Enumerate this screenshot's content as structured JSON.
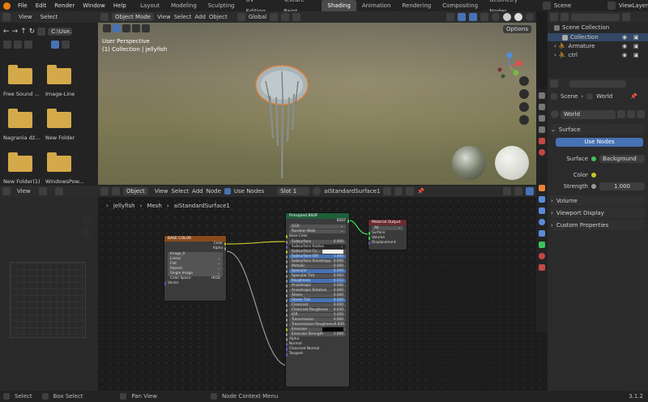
{
  "topbar": {
    "menus": [
      "File",
      "Edit",
      "Render",
      "Window",
      "Help"
    ],
    "workspace_tabs": [
      "Layout",
      "Modeling",
      "Sculpting",
      "UV Editing",
      "Texture Paint",
      "Shading",
      "Animation",
      "Rendering",
      "Compositing",
      "Geometry Nodes"
    ],
    "active_tab": "Shading",
    "scene": "Scene",
    "view_layer": "ViewLayer"
  },
  "file_browser": {
    "header_menus": [
      "View",
      "Select"
    ],
    "path": "C:\\Use...",
    "folders": [
      "Free Sound ...",
      "Image-Line",
      "Nagrania dź...",
      "New Folder",
      "New Folder(1)",
      "WindowsPow..."
    ]
  },
  "viewport": {
    "mode": "Object Mode",
    "menus": [
      "View",
      "Select",
      "Add",
      "Object"
    ],
    "transform": "Global",
    "options": "Options",
    "overlay_title": "User Perspective",
    "overlay_sub": "(1) Collection | jellyfish",
    "gizmo": {
      "x": "X",
      "y": "Y",
      "z": "Z"
    }
  },
  "image_editor": {
    "menus": [
      "View"
    ]
  },
  "node_editor": {
    "object": "Object",
    "menus": [
      "View",
      "Select",
      "Add",
      "Node"
    ],
    "use_nodes": "Use Nodes",
    "slot": "Slot 1",
    "material": "aiStandardSurface1",
    "breadcrumb": [
      "jellyfish",
      "Mesh",
      "aiStandardSurface1"
    ],
    "base_color_node": {
      "title": "BASE COLOR",
      "outputs": [
        "Color",
        "Alpha"
      ],
      "image": "Image_0",
      "options": [
        "Linear",
        "Flat",
        "Repeat",
        "Single Image"
      ],
      "color_space_label": "Color Space",
      "color_space": "sRGB",
      "vector": "Vector"
    },
    "bsdf_node": {
      "title": "Principled BSDF",
      "output": "BSDF",
      "distribution": "GGX",
      "subsurface_method": "Random Walk",
      "inputs": [
        {
          "label": "Base Color",
          "value": "",
          "kind": "plain"
        },
        {
          "label": "Subsurface",
          "value": "0.000",
          "kind": "field"
        },
        {
          "label": "Subsurface Radius",
          "value": "",
          "kind": "drop"
        },
        {
          "label": "Subsurface Co...",
          "value": "",
          "kind": "white"
        },
        {
          "label": "Subsurface IOR",
          "value": "1.400",
          "kind": "fill"
        },
        {
          "label": "Subsurface Anisotropy",
          "value": "0.000",
          "kind": "field"
        },
        {
          "label": "Metallic",
          "value": "0.000",
          "kind": "field"
        },
        {
          "label": "Specular",
          "value": "0.500",
          "kind": "fill"
        },
        {
          "label": "Specular Tint",
          "value": "0.000",
          "kind": "field"
        },
        {
          "label": "Roughness",
          "value": "0.553",
          "kind": "fill"
        },
        {
          "label": "Anisotropic",
          "value": "0.000",
          "kind": "field"
        },
        {
          "label": "Anisotropic Rotation",
          "value": "0.000",
          "kind": "field"
        },
        {
          "label": "Sheen",
          "value": "0.000",
          "kind": "field"
        },
        {
          "label": "Sheen Tint",
          "value": "0.500",
          "kind": "fill"
        },
        {
          "label": "Clearcoat",
          "value": "0.000",
          "kind": "field"
        },
        {
          "label": "Clearcoat Roughness",
          "value": "0.030",
          "kind": "field"
        },
        {
          "label": "IOR",
          "value": "1.450",
          "kind": "field"
        },
        {
          "label": "Transmission",
          "value": "0.000",
          "kind": "field"
        },
        {
          "label": "Transmission Roughness",
          "value": "0.000",
          "kind": "field"
        },
        {
          "label": "Emission",
          "value": "",
          "kind": "black"
        },
        {
          "label": "Emission Strength",
          "value": "1.000",
          "kind": "field"
        },
        {
          "label": "Alpha",
          "value": "",
          "kind": "plain"
        },
        {
          "label": "Normal",
          "value": "",
          "kind": "plain"
        },
        {
          "label": "Clearcoat Normal",
          "value": "",
          "kind": "plain"
        },
        {
          "label": "Tangent",
          "value": "",
          "kind": "plain"
        }
      ]
    },
    "output_node": {
      "title": "Material Output",
      "target": "All",
      "inputs": [
        "Surface",
        "Volume",
        "Displacement"
      ]
    }
  },
  "outliner": {
    "items": [
      "Scene Collection",
      "Collection",
      "Armature",
      "ctrl"
    ]
  },
  "properties": {
    "breadcrumb": [
      "Scene",
      "World"
    ],
    "world_name": "World",
    "surface_panel": "Surface",
    "use_nodes_btn": "Use Nodes",
    "surface_label": "Surface",
    "surface_value": "Background",
    "color_label": "Color",
    "strength_label": "Strength",
    "strength_value": "1.000",
    "panels": [
      "Volume",
      "Viewport Display",
      "Custom Properties"
    ]
  },
  "statusbar": {
    "items": [
      "Select",
      "Box Select",
      "Pan View",
      "Node Context Menu"
    ],
    "version": "3.1.2"
  },
  "colors": {
    "accent": "#4772b3",
    "header": "#2c2c2c",
    "bsdf_header": "#1f5e3a",
    "texture_header": "#8a4a1c",
    "output_header": "#6e2a31",
    "link_yellow": "#c7c729"
  }
}
